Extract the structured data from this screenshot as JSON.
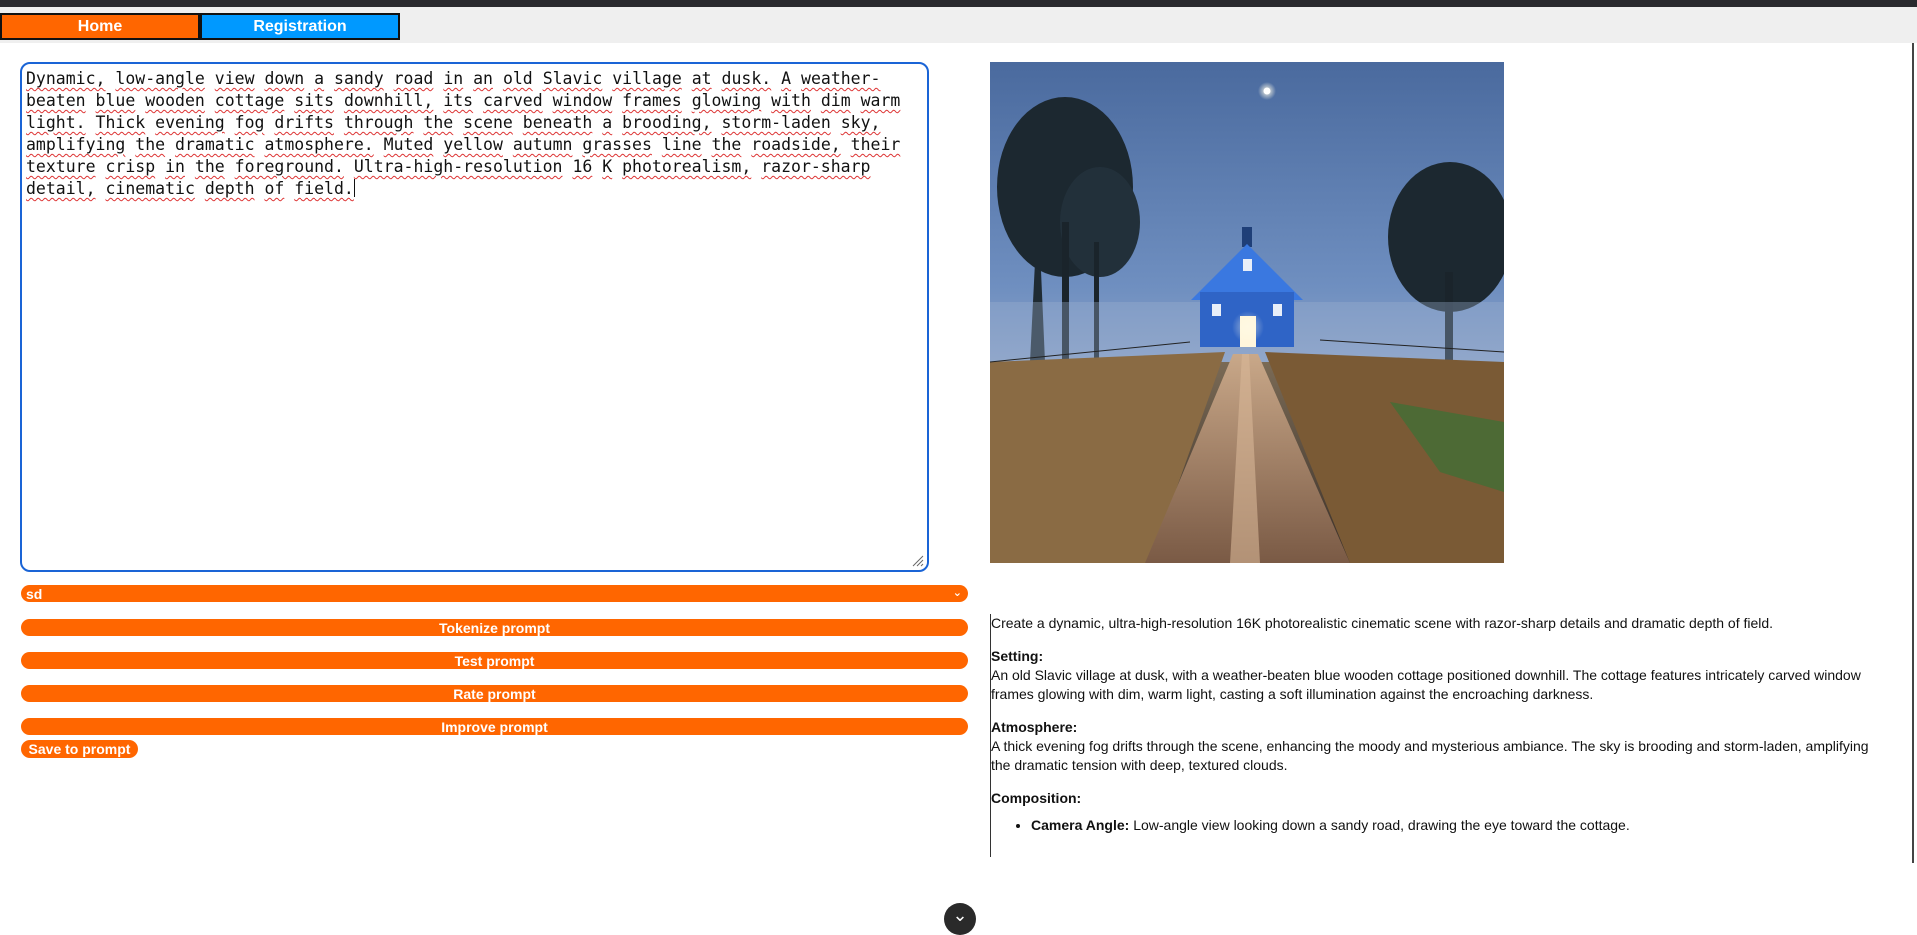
{
  "nav": {
    "home_label": "Home",
    "registration_label": "Registration"
  },
  "prompt": {
    "words": [
      "Dynamic,",
      "low-angle",
      "view",
      "down",
      "a",
      "sandy",
      "road",
      "in",
      "an",
      "old",
      "Slavic",
      "village",
      "at",
      "dusk.",
      "A",
      "weather-beaten",
      "blue",
      "wooden",
      "cottage",
      "sits",
      "downhill,",
      "its",
      "carved",
      "window",
      "frames",
      "glowing",
      "with",
      "dim",
      "warm",
      "light.",
      "Thick",
      "evening",
      "fog",
      "drifts",
      "through",
      "the",
      "scene",
      "beneath",
      "a",
      "brooding,",
      "storm-laden",
      "sky,",
      "amplifying",
      "the",
      "dramatic",
      "atmosphere.",
      "Muted",
      "yellow",
      "autumn",
      "grasses",
      "line",
      "the",
      "roadside,",
      "their",
      "texture",
      "crisp",
      "in",
      "the",
      "foreground.",
      "Ultra-high-resolution",
      "16",
      "K",
      "photorealism,",
      "razor-sharp",
      "detail,",
      "cinematic",
      "depth",
      "of",
      "field."
    ],
    "lines": [
      "Dynamic, low-angle view down a sandy road in an old Slavic village at dusk. A weather-",
      "beaten blue wooden cottage sits downhill, its carved window frames glowing with dim warm",
      "light. Thick evening fog drifts through the scene beneath a brooding, storm-laden sky,",
      "amplifying the dramatic atmosphere. Muted yellow autumn grasses line the roadside, their",
      "texture crisp in the foreground. Ultra-high-resolution 16 K photorealism, razor-sharp",
      "detail, cinematic depth of field."
    ]
  },
  "controls": {
    "model_selected": "sd",
    "tokenize_label": "Tokenize prompt",
    "test_label": "Test prompt",
    "rate_label": "Rate prompt",
    "improve_label": "Improve prompt",
    "save_label": "Save to prompt"
  },
  "result": {
    "intro": "Create a dynamic, ultra-high-resolution 16K photorealistic cinematic scene with razor-sharp details and dramatic depth of field.",
    "setting_heading": "Setting:",
    "setting_text": "An old Slavic village at dusk, with a weather-beaten blue wooden cottage positioned downhill. The cottage features intricately carved window frames glowing with dim, warm light, casting a soft illumination against the encroaching darkness.",
    "atmosphere_heading": "Atmosphere:",
    "atmosphere_text": "A thick evening fog drifts through the scene, enhancing the moody and mysterious ambiance. The sky is brooding and storm-laden, amplifying the dramatic tension with deep, textured clouds.",
    "composition_heading": "Composition:",
    "composition_items": [
      {
        "label": "Camera Angle:",
        "text": "Low-angle view looking down a sandy road, drawing the eye toward the cottage."
      }
    ]
  },
  "colors": {
    "accent_orange": "#ff6600",
    "accent_blue": "#0099ff",
    "focus_border": "#1a64d6"
  },
  "icons": {
    "select_chevron": "chevron-down-icon",
    "scroll_button": "chevron-down-icon"
  }
}
